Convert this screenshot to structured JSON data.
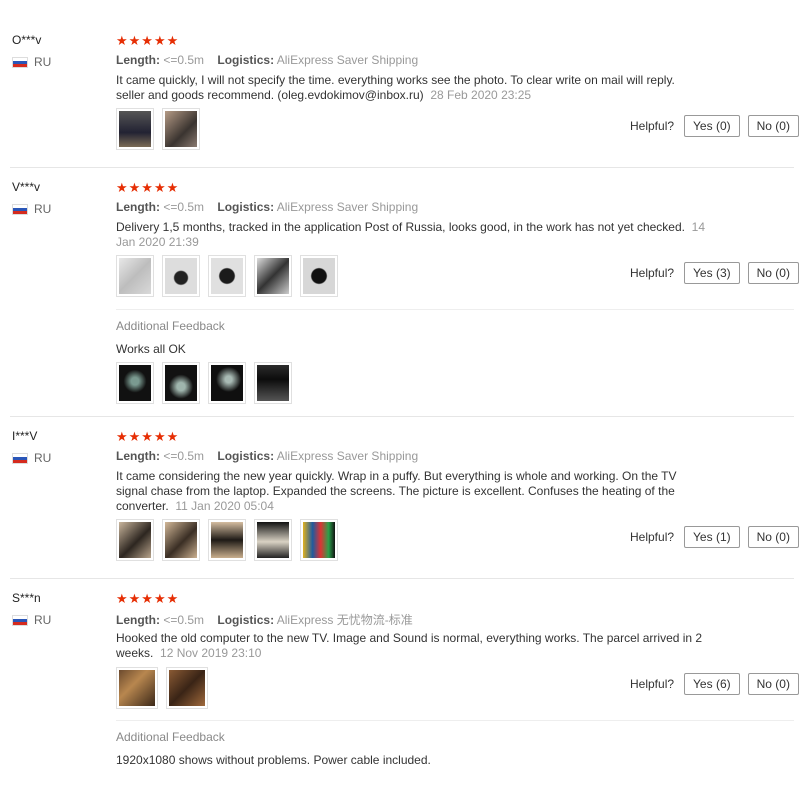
{
  "helpful_label": "Helpful?",
  "length_label": "Length:",
  "logistics_label": "Logistics:",
  "additional_feedback_label": "Additional Feedback",
  "colors": {
    "star": "#e62e04",
    "muted": "#999999"
  },
  "reviews": [
    {
      "user": "O***v",
      "country": "RU",
      "stars": "★★★★★",
      "length": "<=0.5m",
      "logistics": "AliExpress Saver Shipping",
      "text": "It came quickly, I will not specify the time. everything works see the photo. To clear write on mail will reply. seller and goods recommend. (oleg.evdokimov@inbox.ru)",
      "date": "28 Feb 2020 23:25",
      "yes": "Yes (0)",
      "no": "No (0)"
    },
    {
      "user": "V***v",
      "country": "RU",
      "stars": "★★★★★",
      "length": "<=0.5m",
      "logistics": "AliExpress Saver Shipping",
      "text": "Delivery 1,5 months, tracked in the application Post of Russia, looks good, in the work has not yet checked.",
      "date": "14 Jan 2020 21:39",
      "yes": "Yes (3)",
      "no": "No (0)",
      "additional_text": "Works all OK"
    },
    {
      "user": "I***V",
      "country": "RU",
      "stars": "★★★★★",
      "length": "<=0.5m",
      "logistics": "AliExpress Saver Shipping",
      "text": "It came considering the new year quickly. Wrap in a puffy. But everything is whole and working. On the TV signal chase from the laptop. Expanded the screens. The picture is excellent. Confuses the heating of the converter.",
      "date": "11 Jan 2020 05:04",
      "yes": "Yes (1)",
      "no": "No (0)"
    },
    {
      "user": "S***n",
      "country": "RU",
      "stars": "★★★★★",
      "length": "<=0.5m",
      "logistics": "AliExpress 无忧物流-标准",
      "text": "Hooked the old computer to the new TV. Image and Sound is normal, everything works. The parcel arrived in 2 weeks.",
      "date": "12 Nov 2019 23:10",
      "yes": "Yes (6)",
      "no": "No (0)",
      "additional_text": "1920x1080 shows without problems. Power cable included."
    }
  ]
}
